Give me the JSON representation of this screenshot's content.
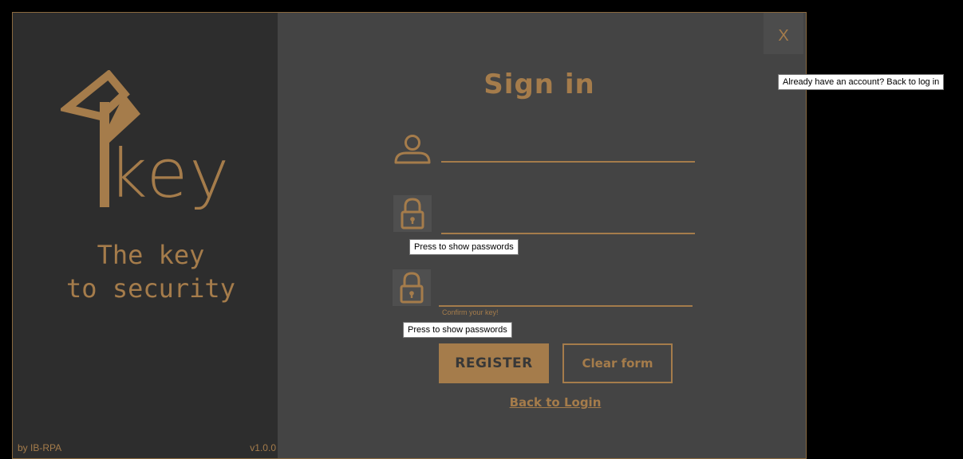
{
  "brand": {
    "logo_word": "key",
    "tagline": "The key\nto security",
    "author": "by IB-RPA",
    "version": "v1.0.0"
  },
  "window": {
    "close_label": "X"
  },
  "form": {
    "title": "Sign in",
    "username_value": "",
    "password_value": "",
    "confirm_value": "",
    "confirm_hint": "Confirm your key!",
    "register_label": "REGISTER",
    "clear_label": "Clear form",
    "back_label": "Back to Login"
  },
  "tooltips": {
    "show_password_1": "Press to show passwords",
    "show_password_2": "Press to show passwords",
    "back_to_login": "Already have an account? Back to log in"
  },
  "colors": {
    "accent": "#a57c4b",
    "panel_dark": "#2d2d2d",
    "panel_main": "#444444",
    "background": "#000000"
  },
  "icons": {
    "logo": "key-logo-icon",
    "user": "user-icon",
    "lock": "lock-icon"
  }
}
